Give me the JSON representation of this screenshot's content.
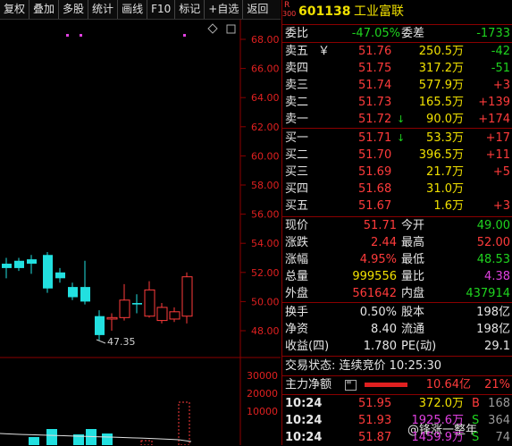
{
  "toolbar": {
    "items": [
      "复权",
      "叠加",
      "多股",
      "统计",
      "画线",
      "F10",
      "标记",
      "+自选",
      "返回"
    ]
  },
  "chart": {
    "price_axis": [
      "68.00",
      "66.00",
      "64.00",
      "62.00",
      "60.00",
      "58.00",
      "56.00",
      "54.00",
      "52.00",
      "50.00",
      "48.00"
    ],
    "volume_axis": [
      "30000",
      "20000",
      "10000"
    ],
    "low_marker": "47.35",
    "candles": [
      {
        "o": 52.6,
        "c": 52.3,
        "h": 53.0,
        "l": 51.6
      },
      {
        "o": 52.8,
        "c": 52.3,
        "h": 53.0,
        "l": 52.1
      },
      {
        "o": 52.9,
        "c": 52.6,
        "h": 53.2,
        "l": 51.9
      },
      {
        "o": 53.2,
        "c": 50.9,
        "h": 53.4,
        "l": 50.6
      },
      {
        "o": 52.0,
        "c": 51.6,
        "h": 52.3,
        "l": 51.3
      },
      {
        "o": 51.0,
        "c": 50.3,
        "h": 51.3,
        "l": 50.1
      },
      {
        "o": 51.0,
        "c": 50.0,
        "h": 52.8,
        "l": 49.8
      },
      {
        "o": 49.0,
        "c": 47.7,
        "h": 49.4,
        "l": 47.35
      },
      {
        "o": 48.8,
        "c": 48.9,
        "h": 49.2,
        "l": 48.0
      },
      {
        "o": 48.9,
        "c": 50.1,
        "h": 51.2,
        "l": 48.7
      },
      {
        "o": 49.9,
        "c": 49.8,
        "h": 50.5,
        "l": 49.2
      },
      {
        "o": 49.0,
        "c": 50.8,
        "h": 51.4,
        "l": 48.9
      },
      {
        "o": 48.7,
        "c": 49.6,
        "h": 49.9,
        "l": 48.5
      },
      {
        "o": 48.8,
        "c": 49.3,
        "h": 49.6,
        "l": 48.6
      },
      {
        "o": 49.0,
        "c": 51.7,
        "h": 52.0,
        "l": 48.5
      }
    ]
  },
  "quote": {
    "code": "601138",
    "name": "工业富联",
    "badge_top": "R",
    "badge_bottom": "300",
    "weibi_label": "委比",
    "weibi": "-47.05%",
    "weicha_label": "委差",
    "weicha": "-1733",
    "sells": [
      {
        "label": "卖五",
        "price": "51.76",
        "vol": "250.5万",
        "chg": "-42",
        "suffix": "￥"
      },
      {
        "label": "卖四",
        "price": "51.75",
        "vol": "317.2万",
        "chg": "-51",
        "suffix": ""
      },
      {
        "label": "卖三",
        "price": "51.74",
        "vol": "577.9万",
        "chg": "+3",
        "suffix": ""
      },
      {
        "label": "卖二",
        "price": "51.73",
        "vol": "165.5万",
        "chg": "+139",
        "suffix": ""
      },
      {
        "label": "卖一",
        "price": "51.72",
        "vol": "90.0万",
        "chg": "+174",
        "suffix": "",
        "arrow": "↓"
      }
    ],
    "buys": [
      {
        "label": "买一",
        "price": "51.71",
        "vol": "53.3万",
        "chg": "+17",
        "arrow": "↓"
      },
      {
        "label": "买二",
        "price": "51.70",
        "vol": "396.5万",
        "chg": "+11"
      },
      {
        "label": "买三",
        "price": "51.69",
        "vol": "21.7万",
        "chg": "+5"
      },
      {
        "label": "买四",
        "price": "51.68",
        "vol": "31.0万",
        "chg": ""
      },
      {
        "label": "买五",
        "price": "51.67",
        "vol": "1.6万",
        "chg": "+3"
      }
    ],
    "stats": [
      {
        "l1": "现价",
        "v1": "51.71",
        "l2": "今开",
        "v2": "49.00"
      },
      {
        "l1": "涨跌",
        "v1": "2.44",
        "l2": "最高",
        "v2": "52.00"
      },
      {
        "l1": "涨幅",
        "v1": "4.95%",
        "l2": "最低",
        "v2": "48.53"
      },
      {
        "l1": "总量",
        "v1": "999556",
        "l2": "量比",
        "v2": "4.38"
      },
      {
        "l1": "外盘",
        "v1": "561642",
        "l2": "内盘",
        "v2": "437914"
      }
    ],
    "fund": [
      {
        "l1": "换手",
        "v1": "0.50%",
        "l2": "股本",
        "v2": "198亿"
      },
      {
        "l1": "净资",
        "v1": "8.40",
        "l2": "流通",
        "v2": "198亿"
      },
      {
        "l1": "收益(四)",
        "v1": "1.780",
        "l2": "PE(动)",
        "v2": "29.1"
      }
    ],
    "trade_status": "交易状态: 连续竞价 10:25:30",
    "main_net_label": "主力净额",
    "main_net_value": "10.64亿",
    "main_net_pct": "21%",
    "ticks": [
      {
        "time": "10:24",
        "price": "51.95",
        "vol": "372.0万",
        "side": "B",
        "num": "168"
      },
      {
        "time": "10:24",
        "price": "51.93",
        "vol": "1925.6万",
        "side": "S",
        "num": "364"
      },
      {
        "time": "10:24",
        "price": "51.87",
        "vol": "1459.9万",
        "side": "S",
        "num": "74"
      }
    ],
    "watermark": "@锋涨一整年"
  }
}
